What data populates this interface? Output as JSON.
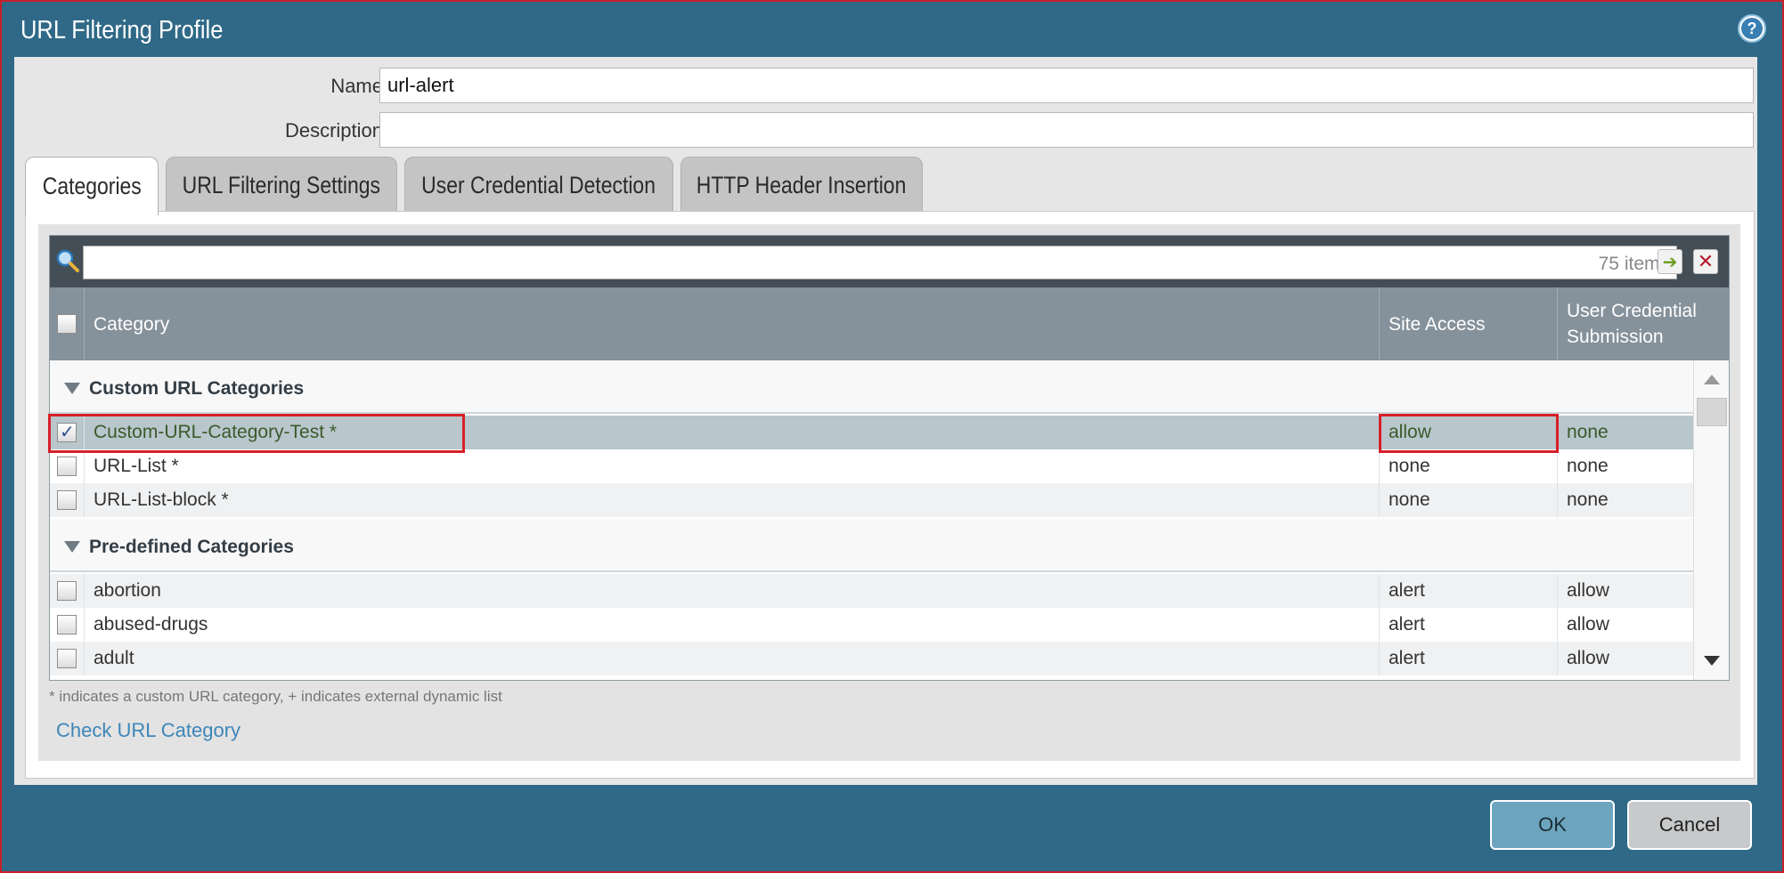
{
  "dialog": {
    "title": "URL Filtering Profile",
    "help_icon": "help-icon"
  },
  "form": {
    "name_label": "Name",
    "name_value": "url-alert",
    "description_label": "Description",
    "description_value": ""
  },
  "tabs": [
    {
      "label": "Categories",
      "active": true
    },
    {
      "label": "URL Filtering Settings",
      "active": false
    },
    {
      "label": "User Credential Detection",
      "active": false
    },
    {
      "label": "HTTP Header Insertion",
      "active": false
    }
  ],
  "grid": {
    "search_value": "",
    "items_count": "75 items",
    "columns": [
      "Category",
      "Site Access",
      "User Credential Submission"
    ],
    "groups": [
      {
        "label": "Custom URL Categories",
        "rows": [
          {
            "category": "Custom-URL-Category-Test *",
            "site_access": "allow",
            "credential": "none",
            "checked": true,
            "selected": true
          },
          {
            "category": "URL-List *",
            "site_access": "none",
            "credential": "none",
            "checked": false,
            "selected": false
          },
          {
            "category": "URL-List-block *",
            "site_access": "none",
            "credential": "none",
            "checked": false,
            "selected": false
          }
        ]
      },
      {
        "label": "Pre-defined Categories",
        "rows": [
          {
            "category": "abortion",
            "site_access": "alert",
            "credential": "allow",
            "checked": false,
            "selected": false
          },
          {
            "category": "abused-drugs",
            "site_access": "alert",
            "credential": "allow",
            "checked": false,
            "selected": false
          },
          {
            "category": "adult",
            "site_access": "alert",
            "credential": "allow",
            "checked": false,
            "selected": false
          }
        ]
      }
    ]
  },
  "footnote": "* indicates a custom URL category, + indicates external dynamic list",
  "check_link": "Check URL Category",
  "buttons": {
    "ok": "OK",
    "cancel": "Cancel"
  },
  "colors": {
    "dialog_bg": "#2f6987",
    "highlight": "#d62029",
    "header_bg": "#85919b",
    "selected_row": "#b9c6cc"
  }
}
